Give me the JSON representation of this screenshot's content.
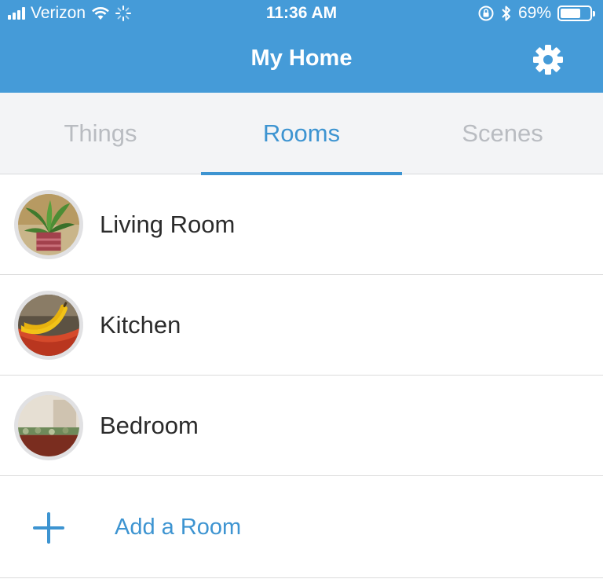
{
  "status_bar": {
    "carrier": "Verizon",
    "time": "11:36 AM",
    "battery": "69%",
    "battery_level": 0.69,
    "icons": [
      "signal-icon",
      "wifi-icon",
      "loading-icon",
      "rotation-lock-icon",
      "bluetooth-icon",
      "battery-icon"
    ]
  },
  "header": {
    "title": "My Home",
    "settings_icon": "gear-icon"
  },
  "tabs": [
    {
      "label": "Things",
      "active": false
    },
    {
      "label": "Rooms",
      "active": true
    },
    {
      "label": "Scenes",
      "active": false
    }
  ],
  "rooms": [
    {
      "name": "Living Room",
      "thumbnail": "plant-photo"
    },
    {
      "name": "Kitchen",
      "thumbnail": "bananas-photo"
    },
    {
      "name": "Bedroom",
      "thumbnail": "bed-photo"
    }
  ],
  "add_room": {
    "label": "Add a Room",
    "icon": "plus-icon"
  },
  "colors": {
    "header_bg": "#459bd8",
    "accent": "#3d94d1",
    "tab_inactive": "#b9bcc1",
    "tab_bar_bg": "#f3f4f6"
  }
}
